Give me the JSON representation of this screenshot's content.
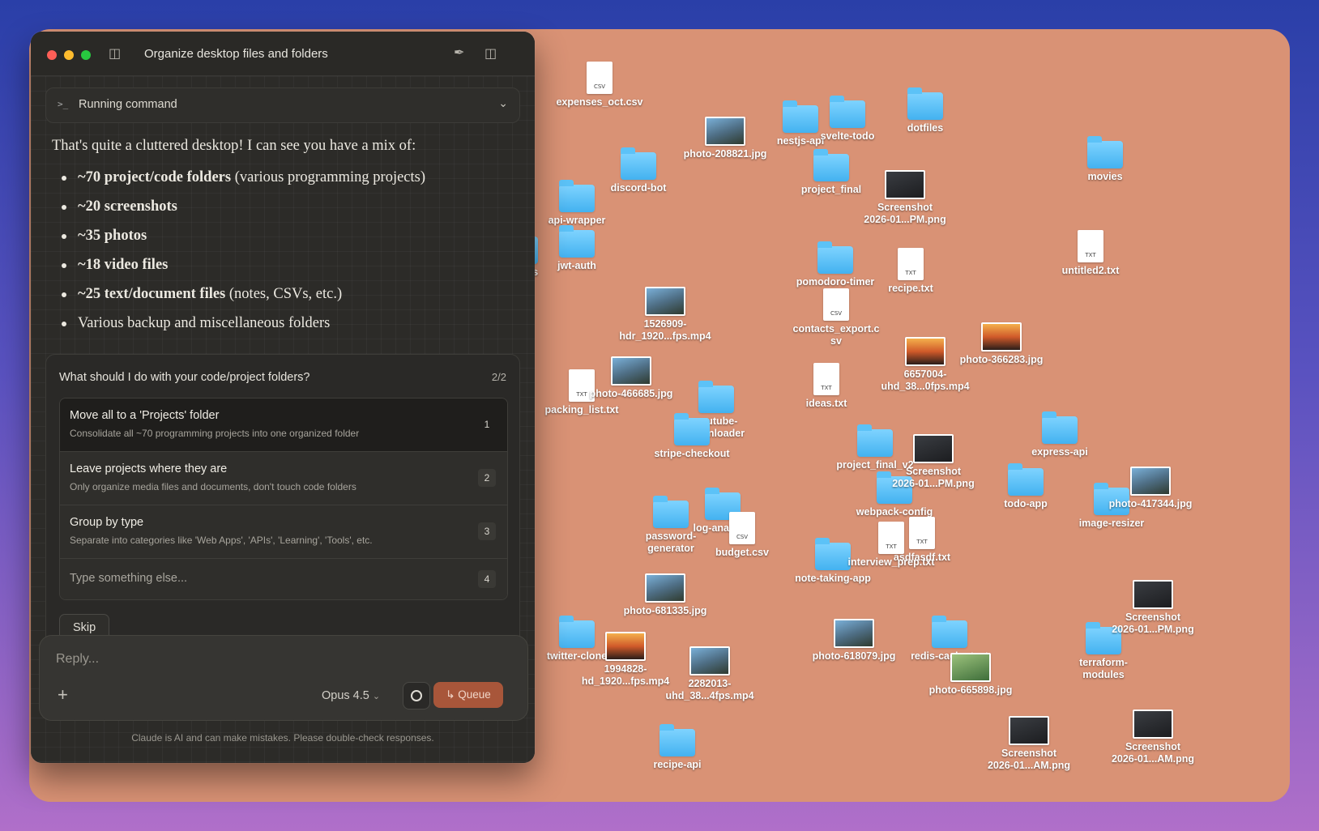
{
  "window": {
    "title": "Organize desktop files and folders",
    "traffic_colors": [
      "#fe5f57",
      "#febc2e",
      "#28c840"
    ]
  },
  "command": {
    "label": "Running command",
    "icon": "terminal-icon"
  },
  "assistant": {
    "intro": "That's quite a cluttered desktop! I can see you have a mix of:",
    "bullets": [
      {
        "bold": "~70 project/code folders",
        "rest": " (various programming projects)"
      },
      {
        "bold": "~20 screenshots",
        "rest": ""
      },
      {
        "bold": "~35 photos",
        "rest": ""
      },
      {
        "bold": "~18 video files",
        "rest": ""
      },
      {
        "bold": "~25 text/document files",
        "rest": " (notes, CSVs, etc.)"
      },
      {
        "bold": "",
        "rest": "Various backup and miscellaneous folders"
      }
    ]
  },
  "question": {
    "title": "What should I do with your code/project folders?",
    "counter": "2/2",
    "options": [
      {
        "title": "Move all to a 'Projects' folder",
        "desc": "Consolidate all ~70 programming projects into one organized folder",
        "key": "1"
      },
      {
        "title": "Leave projects where they are",
        "desc": "Only organize media files and documents, don't touch code folders",
        "key": "2"
      },
      {
        "title": "Group by type",
        "desc": "Separate into categories like 'Web Apps', 'APIs', 'Learning', 'Tools', etc.",
        "key": "3"
      }
    ],
    "other": {
      "placeholder": "Type something else...",
      "key": "4"
    },
    "skip": "Skip"
  },
  "composer": {
    "placeholder": "Reply...",
    "model": "Opus 4.5",
    "queue": "Queue"
  },
  "disclaimer": "Claude is AI and can make mistakes. Please double-check responses.",
  "desktop_items": [
    {
      "kind": "folder",
      "label": "dotfiles"
    },
    {
      "kind": "folder",
      "label": "nestjs-api"
    },
    {
      "kind": "folder",
      "label": "svelte-todo"
    },
    {
      "kind": "folder",
      "label": "discord-bot"
    },
    {
      "kind": "folder",
      "label": "project_final"
    },
    {
      "kind": "folder",
      "label": "api-wrapper"
    },
    {
      "kind": "folder",
      "label": "jwt-auth"
    },
    {
      "kind": "folder",
      "label": "pomodoro-timer"
    },
    {
      "kind": "folder",
      "label": "movies"
    },
    {
      "kind": "folder",
      "label": "youtube-\ndownloader"
    },
    {
      "kind": "folder",
      "label": "project_final_v2"
    },
    {
      "kind": "folder",
      "label": "express-api"
    },
    {
      "kind": "folder",
      "label": "todo-app"
    },
    {
      "kind": "folder",
      "label": "image-resizer"
    },
    {
      "kind": "folder",
      "label": "redis-cache-test"
    },
    {
      "kind": "folder",
      "label": "terraform-\nmodules"
    },
    {
      "kind": "folder",
      "label": "recipe-api"
    },
    {
      "kind": "folder",
      "label": "twitter-clone"
    },
    {
      "kind": "folder",
      "label": "stripe-checkout"
    },
    {
      "kind": "folder",
      "label": "password-\ngenerator"
    },
    {
      "kind": "folder",
      "label": "note-taking-app"
    },
    {
      "kind": "folder",
      "label": "log-analyzer"
    },
    {
      "kind": "folder",
      "label": "configs"
    },
    {
      "kind": "folder",
      "label": "webpack-config"
    },
    {
      "kind": "file",
      "type": "CSV",
      "label": "expenses_oct.csv"
    },
    {
      "kind": "file",
      "type": "CSV",
      "label": "contacts_export.c\nsv"
    },
    {
      "kind": "file",
      "type": "CSV",
      "label": "budget.csv"
    },
    {
      "kind": "file",
      "type": "TXT",
      "label": "recipe.txt"
    },
    {
      "kind": "file",
      "type": "TXT",
      "label": "ideas.txt"
    },
    {
      "kind": "file",
      "type": "TXT",
      "label": "untitled2.txt"
    },
    {
      "kind": "file",
      "type": "TXT",
      "label": "packing_list.txt"
    },
    {
      "kind": "file",
      "type": "TXT",
      "label": "asdfasdf.txt"
    },
    {
      "kind": "file",
      "type": "TXT",
      "label": "interview_prep.txt"
    },
    {
      "kind": "image",
      "style": "t-dark",
      "label": "Screenshot\n2026-01...PM.png"
    },
    {
      "kind": "image",
      "style": "t-photo",
      "label": "photo-208821.jpg"
    },
    {
      "kind": "image",
      "style": "t-sunset",
      "label": "photo-366283.jpg"
    },
    {
      "kind": "image",
      "style": "t-photo",
      "label": "photo-466685.jpg"
    },
    {
      "kind": "image",
      "style": "t-dark",
      "label": "Screenshot\n2026-01...PM.png"
    },
    {
      "kind": "image",
      "style": "t-dark",
      "label": "Screenshot\n2026-01...PM.png"
    },
    {
      "kind": "image",
      "style": "t-photo",
      "label": "photo-681335.jpg"
    },
    {
      "kind": "image",
      "style": "t-photo",
      "label": "photo-618079.jpg"
    },
    {
      "kind": "image",
      "style": "t-photo",
      "label": "photo-417344.jpg"
    },
    {
      "kind": "image",
      "style": "t-green",
      "label": "photo-665898.jpg"
    },
    {
      "kind": "image",
      "style": "t-dark",
      "label": "Screenshot\n2026-01...AM.png"
    },
    {
      "kind": "image",
      "style": "t-dark",
      "label": "Screenshot\n2026-01...AM.png"
    },
    {
      "kind": "image",
      "style": "t-sunset",
      "label": "1994828-\nhd_1920...fps.mp4"
    },
    {
      "kind": "image",
      "style": "t-photo",
      "label": "2282013-\nuhd_38...4fps.mp4"
    },
    {
      "kind": "image",
      "style": "t-photo",
      "label": "1526909-\nhdr_1920...fps.mp4"
    },
    {
      "kind": "image",
      "style": "t-sunset",
      "label": "6657004-\nuhd_38...0fps.mp4"
    }
  ]
}
